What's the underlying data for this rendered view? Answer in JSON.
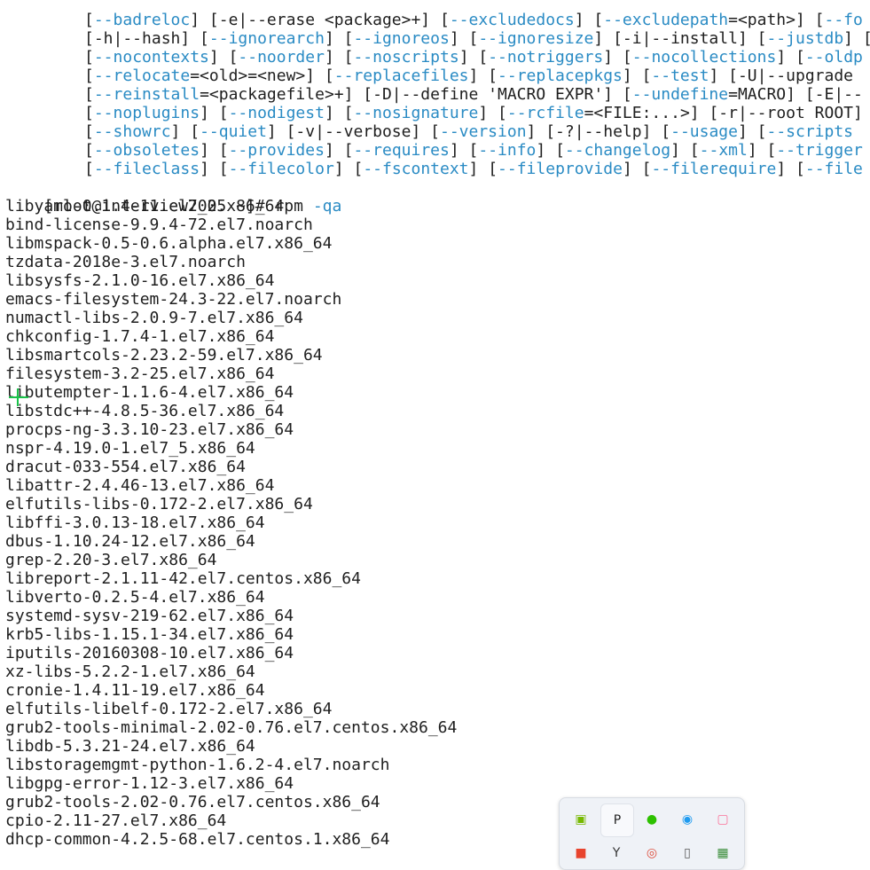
{
  "usage_lines": [
    [
      {
        "t": "[",
        "c": "t"
      },
      {
        "t": "--badreloc",
        "c": "o"
      },
      {
        "t": "] [-e|--erase <package>+] [",
        "c": "t"
      },
      {
        "t": "--excludedocs",
        "c": "o"
      },
      {
        "t": "] [",
        "c": "t"
      },
      {
        "t": "--excludepath",
        "c": "o"
      },
      {
        "t": "=<path>] [",
        "c": "t"
      },
      {
        "t": "--fo",
        "c": "o"
      }
    ],
    [
      {
        "t": "[-h|--hash] [",
        "c": "t"
      },
      {
        "t": "--ignorearch",
        "c": "o"
      },
      {
        "t": "] [",
        "c": "t"
      },
      {
        "t": "--ignoreos",
        "c": "o"
      },
      {
        "t": "] [",
        "c": "t"
      },
      {
        "t": "--ignoresize",
        "c": "o"
      },
      {
        "t": "] [-i|--install] [",
        "c": "t"
      },
      {
        "t": "--justdb",
        "c": "o"
      },
      {
        "t": "] [",
        "c": "t"
      }
    ],
    [
      {
        "t": "[",
        "c": "t"
      },
      {
        "t": "--nocontexts",
        "c": "o"
      },
      {
        "t": "] [",
        "c": "t"
      },
      {
        "t": "--noorder",
        "c": "o"
      },
      {
        "t": "] [",
        "c": "t"
      },
      {
        "t": "--noscripts",
        "c": "o"
      },
      {
        "t": "] [",
        "c": "t"
      },
      {
        "t": "--notriggers",
        "c": "o"
      },
      {
        "t": "] [",
        "c": "t"
      },
      {
        "t": "--nocollections",
        "c": "o"
      },
      {
        "t": "] [",
        "c": "t"
      },
      {
        "t": "--oldp",
        "c": "o"
      }
    ],
    [
      {
        "t": "[",
        "c": "t"
      },
      {
        "t": "--relocate",
        "c": "o"
      },
      {
        "t": "=<old>=<new>] [",
        "c": "t"
      },
      {
        "t": "--replacefiles",
        "c": "o"
      },
      {
        "t": "] [",
        "c": "t"
      },
      {
        "t": "--replacepkgs",
        "c": "o"
      },
      {
        "t": "] [",
        "c": "t"
      },
      {
        "t": "--test",
        "c": "o"
      },
      {
        "t": "] [-U|--upgrade",
        "c": "t"
      }
    ],
    [
      {
        "t": "[",
        "c": "t"
      },
      {
        "t": "--reinstall",
        "c": "o"
      },
      {
        "t": "=<packagefile>+] [-D|--define 'MACRO EXPR'] [",
        "c": "t"
      },
      {
        "t": "--undefine",
        "c": "o"
      },
      {
        "t": "=MACRO] [-E|--",
        "c": "t"
      }
    ],
    [
      {
        "t": "[",
        "c": "t"
      },
      {
        "t": "--noplugins",
        "c": "o"
      },
      {
        "t": "] [",
        "c": "t"
      },
      {
        "t": "--nodigest",
        "c": "o"
      },
      {
        "t": "] [",
        "c": "t"
      },
      {
        "t": "--nosignature",
        "c": "o"
      },
      {
        "t": "] [",
        "c": "t"
      },
      {
        "t": "--rcfile",
        "c": "o"
      },
      {
        "t": "=<FILE:...>] [-r|--root ROOT]",
        "c": "t"
      }
    ],
    [
      {
        "t": "[",
        "c": "t"
      },
      {
        "t": "--showrc",
        "c": "o"
      },
      {
        "t": "] [",
        "c": "t"
      },
      {
        "t": "--quiet",
        "c": "o"
      },
      {
        "t": "] [-v|--verbose] [",
        "c": "t"
      },
      {
        "t": "--version",
        "c": "o"
      },
      {
        "t": "] [-?|--help] [",
        "c": "t"
      },
      {
        "t": "--usage",
        "c": "o"
      },
      {
        "t": "] [",
        "c": "t"
      },
      {
        "t": "--scripts",
        "c": "o"
      }
    ],
    [
      {
        "t": "[",
        "c": "t"
      },
      {
        "t": "--obsoletes",
        "c": "o"
      },
      {
        "t": "] [",
        "c": "t"
      },
      {
        "t": "--provides",
        "c": "o"
      },
      {
        "t": "] [",
        "c": "t"
      },
      {
        "t": "--requires",
        "c": "o"
      },
      {
        "t": "] [",
        "c": "t"
      },
      {
        "t": "--info",
        "c": "o"
      },
      {
        "t": "] [",
        "c": "t"
      },
      {
        "t": "--changelog",
        "c": "o"
      },
      {
        "t": "] [",
        "c": "t"
      },
      {
        "t": "--xml",
        "c": "o"
      },
      {
        "t": "] [",
        "c": "t"
      },
      {
        "t": "--trigger",
        "c": "o"
      }
    ],
    [
      {
        "t": "[",
        "c": "t"
      },
      {
        "t": "--fileclass",
        "c": "o"
      },
      {
        "t": "] [",
        "c": "t"
      },
      {
        "t": "--filecolor",
        "c": "o"
      },
      {
        "t": "] [",
        "c": "t"
      },
      {
        "t": "--fscontext",
        "c": "o"
      },
      {
        "t": "] [",
        "c": "t"
      },
      {
        "t": "--fileprovide",
        "c": "o"
      },
      {
        "t": "] [",
        "c": "t"
      },
      {
        "t": "--filerequire",
        "c": "o"
      },
      {
        "t": "] [",
        "c": "t"
      },
      {
        "t": "--file",
        "c": "o"
      }
    ]
  ],
  "prompt": {
    "text": "[root@interview2025 ~]# ",
    "command": "rpm",
    "flag": "-qa"
  },
  "packages": [
    "libyaml-0.1.4-11.el7_0.x86_64",
    "bind-license-9.9.4-72.el7.noarch",
    "libmspack-0.5-0.6.alpha.el7.x86_64",
    "tzdata-2018e-3.el7.noarch",
    "libsysfs-2.1.0-16.el7.x86_64",
    "emacs-filesystem-24.3-22.el7.noarch",
    "numactl-libs-2.0.9-7.el7.x86_64",
    "chkconfig-1.7.4-1.el7.x86_64",
    "libsmartcols-2.23.2-59.el7.x86_64",
    "filesystem-3.2-25.el7.x86_64",
    "libutempter-1.1.6-4.el7.x86_64",
    "libstdc++-4.8.5-36.el7.x86_64",
    "procps-ng-3.3.10-23.el7.x86_64",
    "nspr-4.19.0-1.el7_5.x86_64",
    "dracut-033-554.el7.x86_64",
    "libattr-2.4.46-13.el7.x86_64",
    "elfutils-libs-0.172-2.el7.x86_64",
    "libffi-3.0.13-18.el7.x86_64",
    "dbus-1.10.24-12.el7.x86_64",
    "grep-2.20-3.el7.x86_64",
    "libreport-2.1.11-42.el7.centos.x86_64",
    "libverto-0.2.5-4.el7.x86_64",
    "systemd-sysv-219-62.el7.x86_64",
    "krb5-libs-1.15.1-34.el7.x86_64",
    "iputils-20160308-10.el7.x86_64",
    "xz-libs-5.2.2-1.el7.x86_64",
    "cronie-1.4.11-19.el7.x86_64",
    "elfutils-libelf-0.172-2.el7.x86_64",
    "grub2-tools-minimal-2.02-0.76.el7.centos.x86_64",
    "libdb-5.3.21-24.el7.x86_64",
    "libstoragemgmt-python-1.6.2-4.el7.noarch",
    "libgpg-error-1.12-3.el7.x86_64",
    "grub2-tools-2.02-0.76.el7.centos.x86_64",
    "cpio-2.11-27.el7.x86_64",
    "dhcp-common-4.2.5-68.el7.centos.1.x86_64"
  ],
  "tray": {
    "icons": [
      {
        "name": "nvidia-icon",
        "glyph": "▣",
        "color": "#76b900",
        "active": false
      },
      {
        "name": "pycharm-icon",
        "glyph": "P",
        "color": "#222222",
        "active": true
      },
      {
        "name": "wechat-icon",
        "glyph": "●",
        "color": "#2dc100",
        "active": false
      },
      {
        "name": "qq-icon",
        "glyph": "◉",
        "color": "#1e9bf0",
        "active": false
      },
      {
        "name": "bilibili-icon",
        "glyph": "▢",
        "color": "#fb7299",
        "active": false
      },
      {
        "name": "app-red-icon",
        "glyph": "■",
        "color": "#e8442e",
        "active": false
      },
      {
        "name": "app-dark-icon",
        "glyph": "Y",
        "color": "#333333",
        "active": false
      },
      {
        "name": "chrome-icon",
        "glyph": "◎",
        "color": "#dd4b39",
        "active": false
      },
      {
        "name": "usb-icon",
        "glyph": "▯",
        "color": "#555555",
        "active": false
      },
      {
        "name": "app-grid-icon",
        "glyph": "▦",
        "color": "#3a8d3a",
        "active": false
      }
    ]
  }
}
